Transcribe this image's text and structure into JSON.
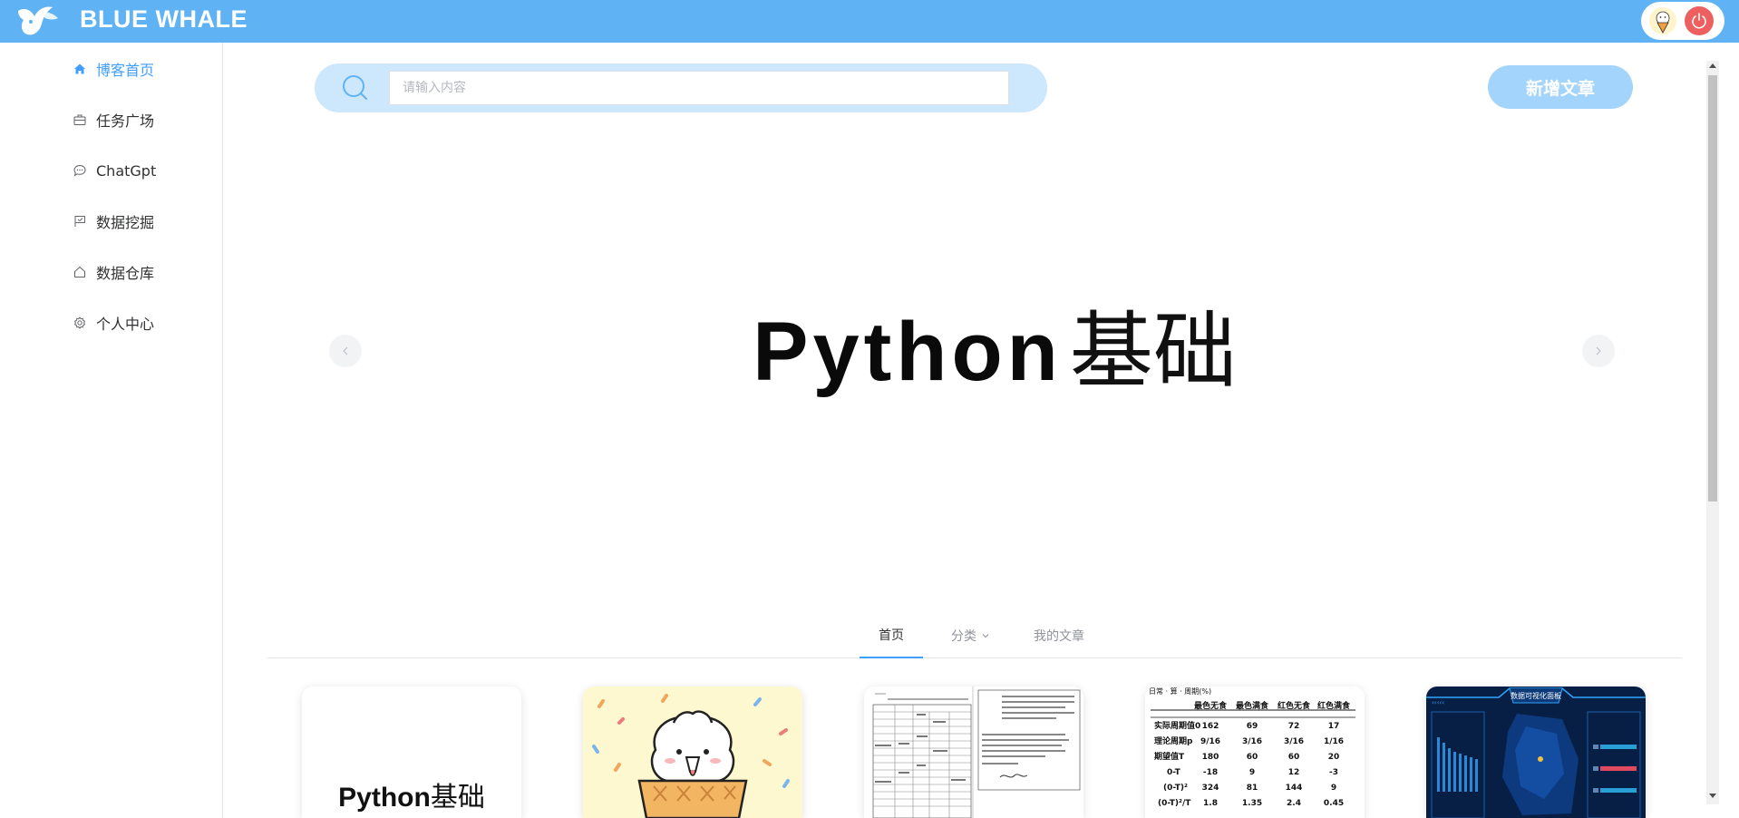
{
  "header": {
    "brand": "BLUE WHALE",
    "logo_icon": "whale-logo-icon",
    "bg_color": "#5fb3f5",
    "power_icon": "power-icon"
  },
  "sidebar": {
    "items": [
      {
        "label": "博客首页",
        "icon": "home-icon",
        "active": true
      },
      {
        "label": "任务广场",
        "icon": "briefcase-icon",
        "active": false
      },
      {
        "label": "ChatGpt",
        "icon": "chat-bubble-icon",
        "active": false
      },
      {
        "label": "数据挖掘",
        "icon": "flag-icon",
        "active": false
      },
      {
        "label": "数据仓库",
        "icon": "house-outline-icon",
        "active": false
      },
      {
        "label": "个人中心",
        "icon": "gear-icon",
        "active": false
      }
    ],
    "active_color": "#409eff"
  },
  "search": {
    "placeholder": "请输入内容",
    "value": ""
  },
  "toolbar": {
    "new_article_label": "新增文章"
  },
  "carousel": {
    "slide_text_latin": "Python",
    "slide_text_cjk": "基础"
  },
  "tabs": [
    {
      "label": "首页",
      "active": true
    },
    {
      "label": "分类",
      "active": false,
      "has_dropdown": true
    },
    {
      "label": "我的文章",
      "active": false
    }
  ],
  "cards": [
    {
      "thumb_text_latin": "Python",
      "thumb_text_cjk": "基础"
    },
    {
      "thumb_desc": "sticker"
    },
    {
      "thumb_desc": "document"
    },
    {
      "thumb_title": "日常 · 算 · 周期(%)",
      "table_headers": [
        "最色无食",
        "最色满食",
        "红色无食",
        "红色满食"
      ],
      "table_rows": [
        [
          "实际周期值0",
          "162",
          "69",
          "72",
          "17"
        ],
        [
          "理论周期p",
          "9/16",
          "3/16",
          "3/16",
          "1/16"
        ],
        [
          "期望值T",
          "180",
          "60",
          "60",
          "20"
        ],
        [
          "0-T",
          "-18",
          "9",
          "12",
          "-3"
        ],
        [
          "(0-T)²",
          "324",
          "81",
          "144",
          "9"
        ],
        [
          "(0-T)²/T",
          "1.8",
          "1.35",
          "2.4",
          "0.45"
        ]
      ]
    },
    {
      "thumb_title": "数据可视化面板",
      "thumb_back": "‹‹‹‹‹"
    }
  ]
}
